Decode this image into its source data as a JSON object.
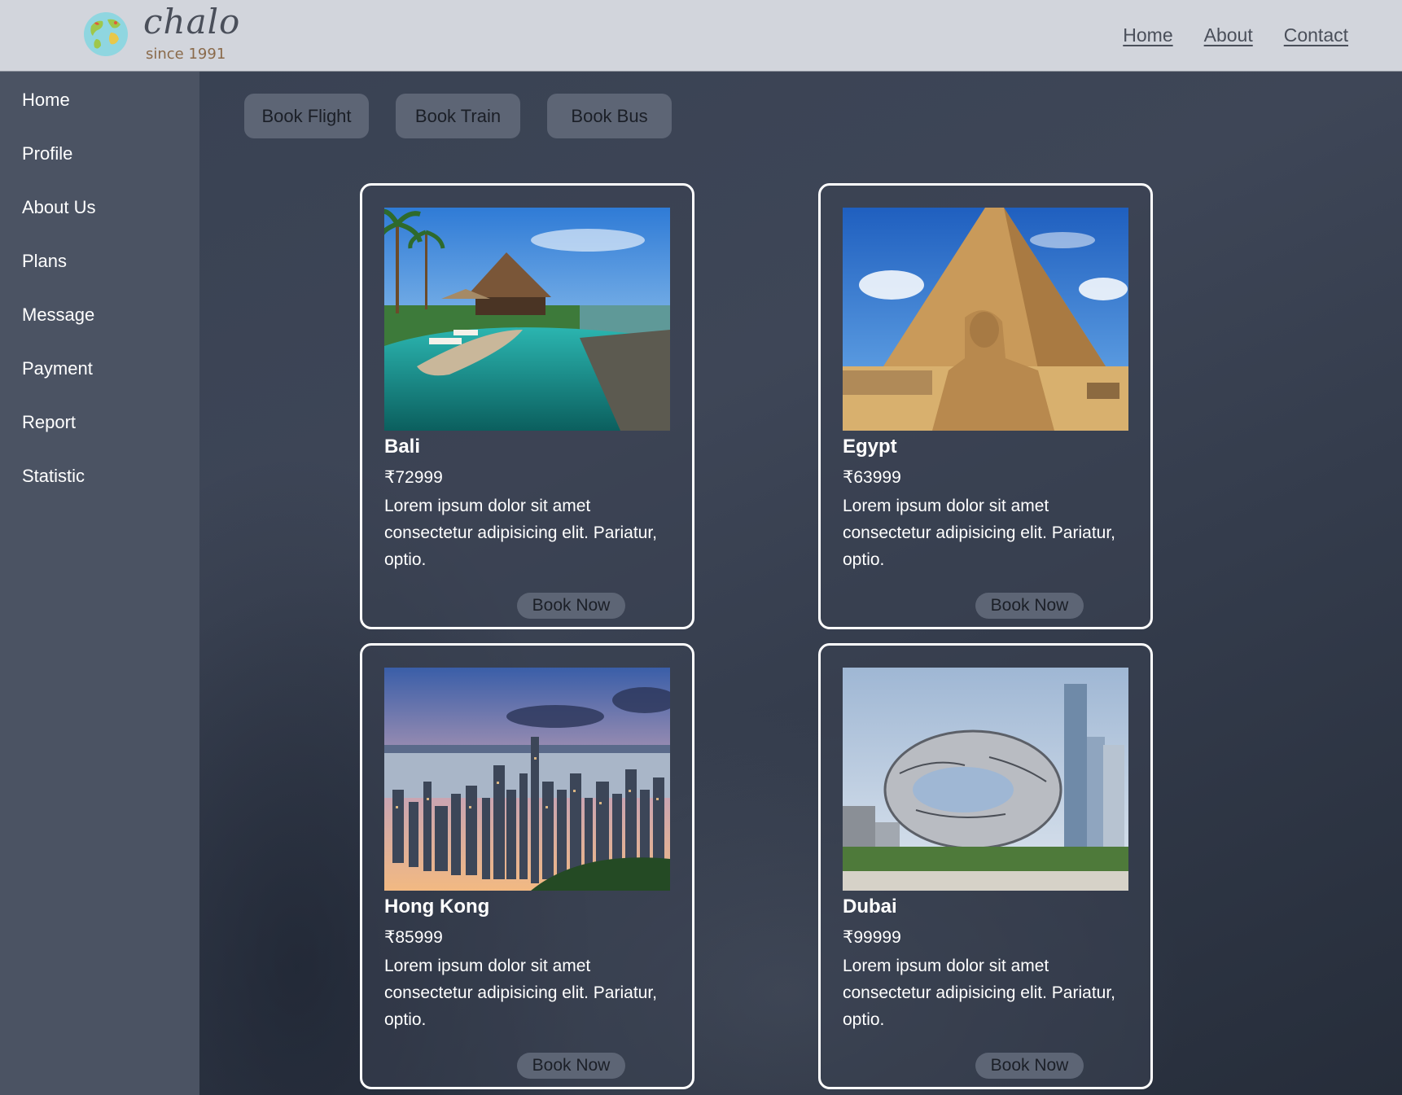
{
  "brand": {
    "name": "chalo",
    "tagline": "since 1991",
    "logo_icon": "globe-icon"
  },
  "topnav": {
    "items": [
      {
        "label": "Home"
      },
      {
        "label": "About"
      },
      {
        "label": "Contact"
      }
    ]
  },
  "sidebar": {
    "items": [
      {
        "label": "Home"
      },
      {
        "label": "Profile"
      },
      {
        "label": "About Us"
      },
      {
        "label": "Plans"
      },
      {
        "label": "Message"
      },
      {
        "label": "Payment"
      },
      {
        "label": "Report"
      },
      {
        "label": "Statistic"
      }
    ]
  },
  "booking": {
    "flight": "Book Flight",
    "train": "Book Train",
    "bus": "Book Bus"
  },
  "cards": [
    {
      "title": "Bali",
      "price": "₹72999",
      "description": "Lorem ipsum dolor sit amet consectetur adipisicing elit. Pariatur, optio.",
      "button": "Book Now",
      "image": "bali-resort-pool"
    },
    {
      "title": "Egypt",
      "price": "₹63999",
      "description": "Lorem ipsum dolor sit amet consectetur adipisicing elit. Pariatur, optio.",
      "button": "Book Now",
      "image": "pyramid-and-sphinx"
    },
    {
      "title": "Hong Kong",
      "price": "₹85999",
      "description": "Lorem ipsum dolor sit amet consectetur adipisicing elit. Pariatur, optio.",
      "button": "Book Now",
      "image": "hong-kong-skyline"
    },
    {
      "title": "Dubai",
      "price": "₹99999",
      "description": "Lorem ipsum dolor sit amet consectetur adipisicing elit. Pariatur, optio.",
      "button": "Book Now",
      "image": "museum-of-the-future"
    }
  ],
  "colors": {
    "header_bg": "#d2d5dc",
    "sidebar_bg": "#4b5363",
    "main_bg": "#343c4c",
    "button_bg": "#5d6575",
    "card_border": "#ffffff"
  }
}
